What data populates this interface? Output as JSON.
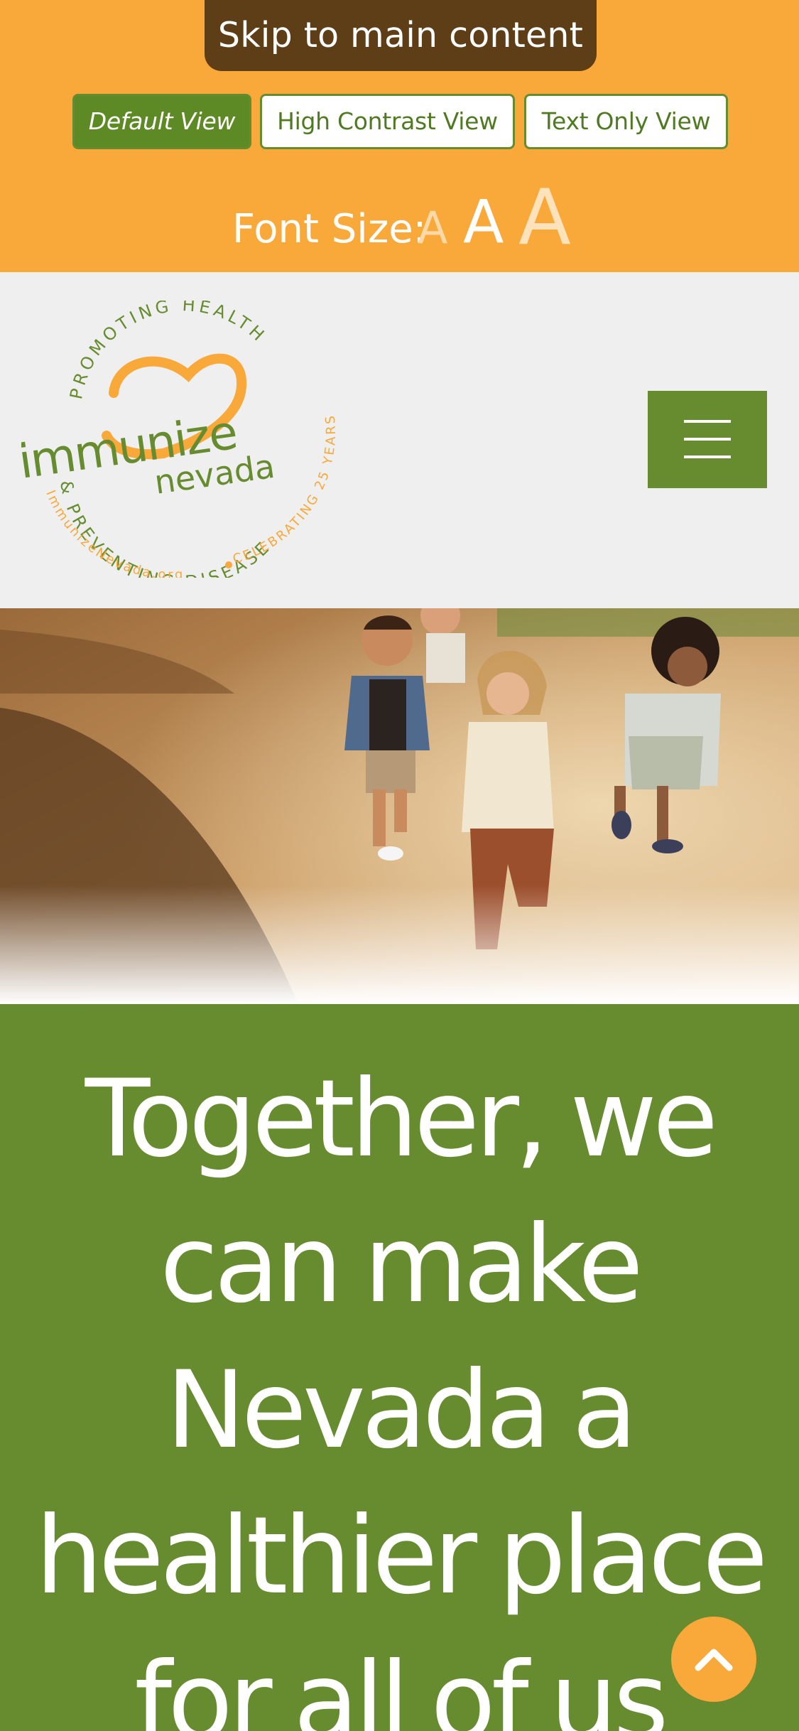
{
  "accessibility_bar": {
    "skip_link": "Skip to main content",
    "views": [
      {
        "label": "Default View",
        "active": true
      },
      {
        "label": "High Contrast View",
        "active": false
      },
      {
        "label": "Text Only View",
        "active": false
      }
    ],
    "font_size_label": "Font Size:",
    "font_size_options": [
      "A",
      "A",
      "A"
    ]
  },
  "header": {
    "logo": {
      "arc_top": "PROMOTING HEALTH",
      "arc_bottom": "& PREVENTING DISEASE",
      "arc_right": "CELEBRATING 25 YEARS",
      "arc_url": "ImmunizeNevada.org",
      "word_1": "immunize",
      "word_2": "nevada"
    },
    "menu_icon": "hamburger-menu-icon"
  },
  "hero": {
    "image_subject": "children-running-outdoors-photo"
  },
  "main": {
    "headline": "Together, we can make Nevada a healthier place for all of us"
  },
  "back_to_top_icon": "chevron-up-icon",
  "colors": {
    "brand_orange": "#f9a83a",
    "brand_green": "#678c2f",
    "skip_link_brown": "#5e3e16",
    "header_gray": "#efefef"
  }
}
